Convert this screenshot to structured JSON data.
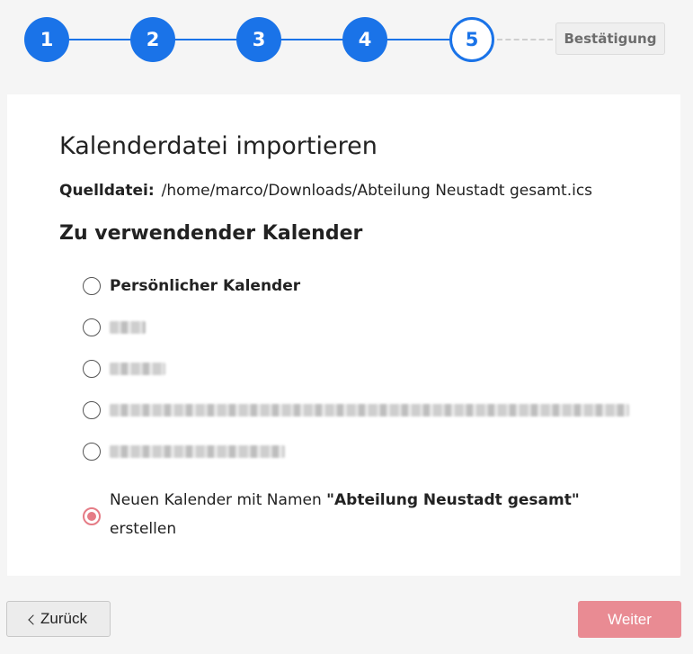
{
  "stepper": {
    "steps": [
      "1",
      "2",
      "3",
      "4",
      "5"
    ],
    "current_step": "5",
    "confirm_label": "Bestätigung",
    "accent_color": "#1a73e8"
  },
  "card": {
    "title": "Kalenderdatei importieren",
    "source_label": "Quelldatei:",
    "source_path": "/home/marco/Downloads/Abteilung Neustadt gesamt.ics",
    "subheading": "Zu verwendender Kalender",
    "options": [
      {
        "label": "Persönlicher Kalender",
        "checked": false,
        "redacted": false
      },
      {
        "label": "",
        "checked": false,
        "redacted": true
      },
      {
        "label": "",
        "checked": false,
        "redacted": true
      },
      {
        "label": "",
        "checked": false,
        "redacted": true
      },
      {
        "label": "",
        "checked": false,
        "redacted": true
      }
    ],
    "new_calendar": {
      "prefix": "Neuen Kalender mit Namen",
      "name": "\"Abteilung Neustadt gesamt\"",
      "suffix": "erstellen",
      "checked": true
    }
  },
  "footer": {
    "back_label": "Zurück",
    "next_label": "Weiter",
    "next_color": "#e98b93"
  }
}
